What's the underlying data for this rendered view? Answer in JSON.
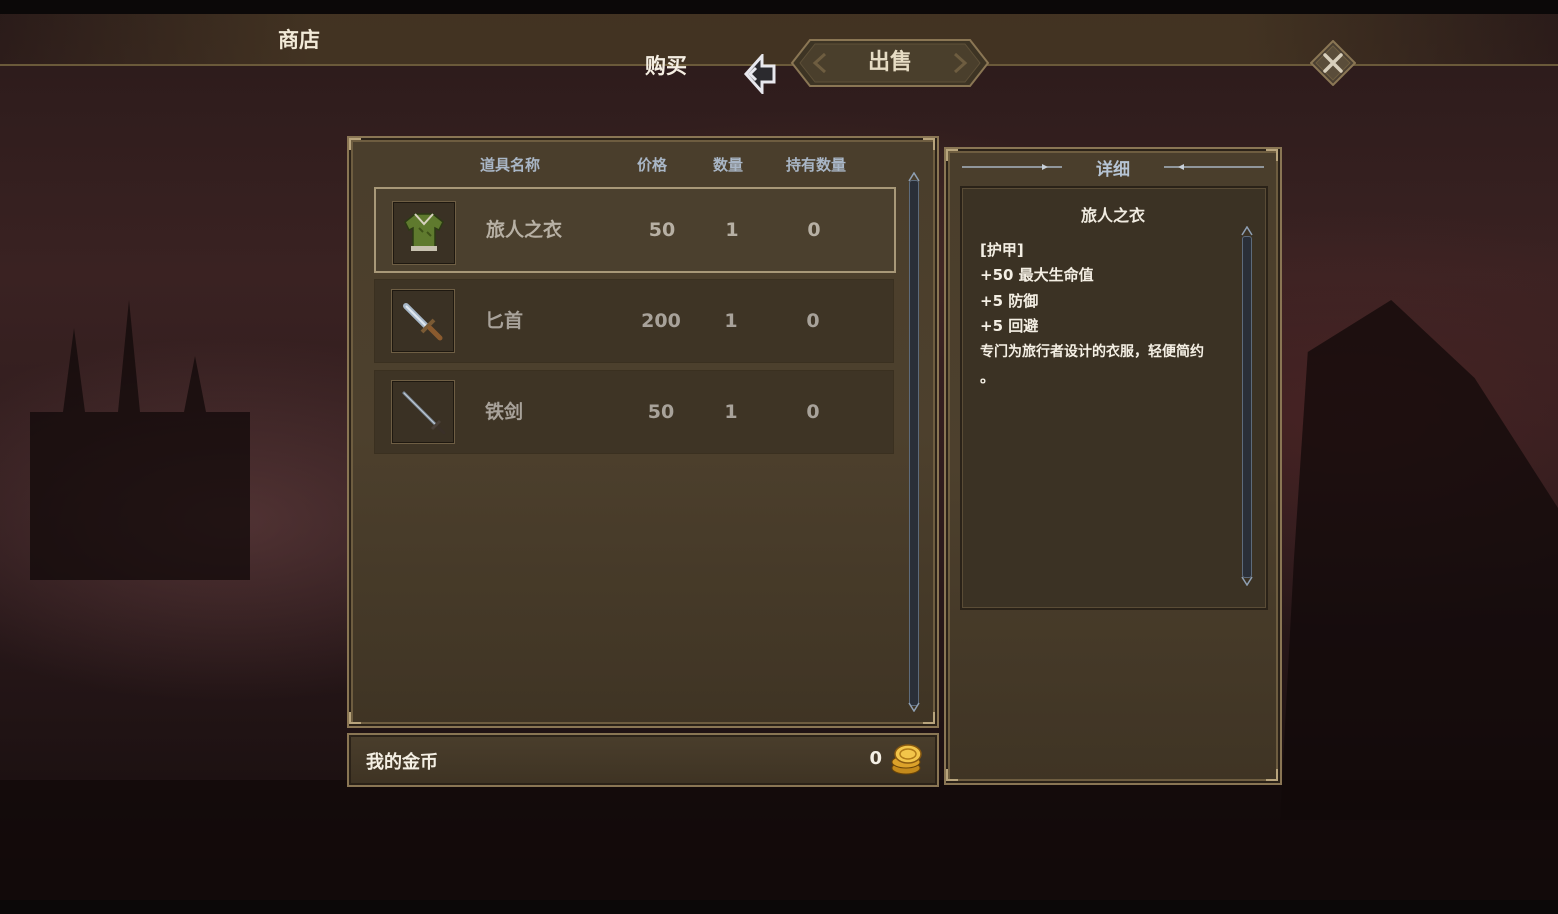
{
  "shop": {
    "title": "商店",
    "tab_buy": "购买",
    "tab_sell": "出售"
  },
  "list": {
    "headers": {
      "name": "道具名称",
      "price": "价格",
      "qty": "数量",
      "owned": "持有数量"
    },
    "items": [
      {
        "name": "旅人之衣",
        "price": "50",
        "qty": "1",
        "owned": "0",
        "icon": "green-tunic-icon",
        "selected": true
      },
      {
        "name": "匕首",
        "price": "200",
        "qty": "1",
        "owned": "0",
        "icon": "dagger-icon",
        "selected": false
      },
      {
        "name": "铁剑",
        "price": "50",
        "qty": "1",
        "owned": "0",
        "icon": "iron-sword-icon",
        "selected": false
      }
    ]
  },
  "detail": {
    "header": "详细",
    "title": "旅人之衣",
    "lines": [
      "[护甲]",
      "+50 最大生命值",
      "+5 防御",
      "+5 回避",
      "专门为旅行者设计的衣服，轻便简约",
      "。"
    ]
  },
  "gold": {
    "label": "我的金币",
    "value": "0"
  },
  "colors": {
    "panel": "#4a3e2c",
    "frame": "#8a7654",
    "header_text": "#a9b6c6",
    "text": "#f4efe4"
  }
}
